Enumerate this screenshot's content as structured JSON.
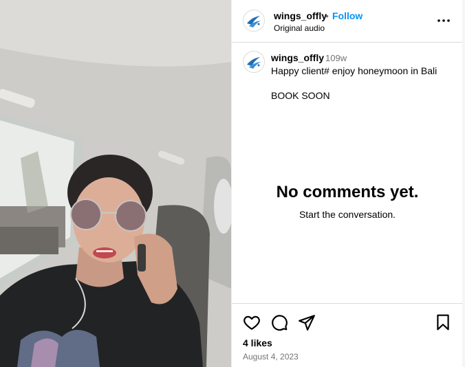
{
  "post": {
    "username": "wings_offly",
    "separator": "•",
    "follow_label": "Follow",
    "audio_label": "Original audio"
  },
  "caption": {
    "username": "wings_offly",
    "time": "109w",
    "line1": "Happy client# enjoy honeymoon in Bali",
    "line2": "BOOK SOON"
  },
  "comments": {
    "empty_title": "No comments yet.",
    "empty_subtitle": "Start the conversation."
  },
  "footer": {
    "likes": "4 likes",
    "date": "August 4, 2023"
  },
  "icons": {
    "avatar": "wings-logo-icon",
    "more": "more-options-icon",
    "like": "heart-icon",
    "comment": "comment-icon",
    "share": "share-icon",
    "save": "bookmark-icon"
  },
  "colors": {
    "follow": "#0095f6",
    "muted": "#737373",
    "border": "#dbdbdb",
    "logo": "#1f6fb5"
  }
}
